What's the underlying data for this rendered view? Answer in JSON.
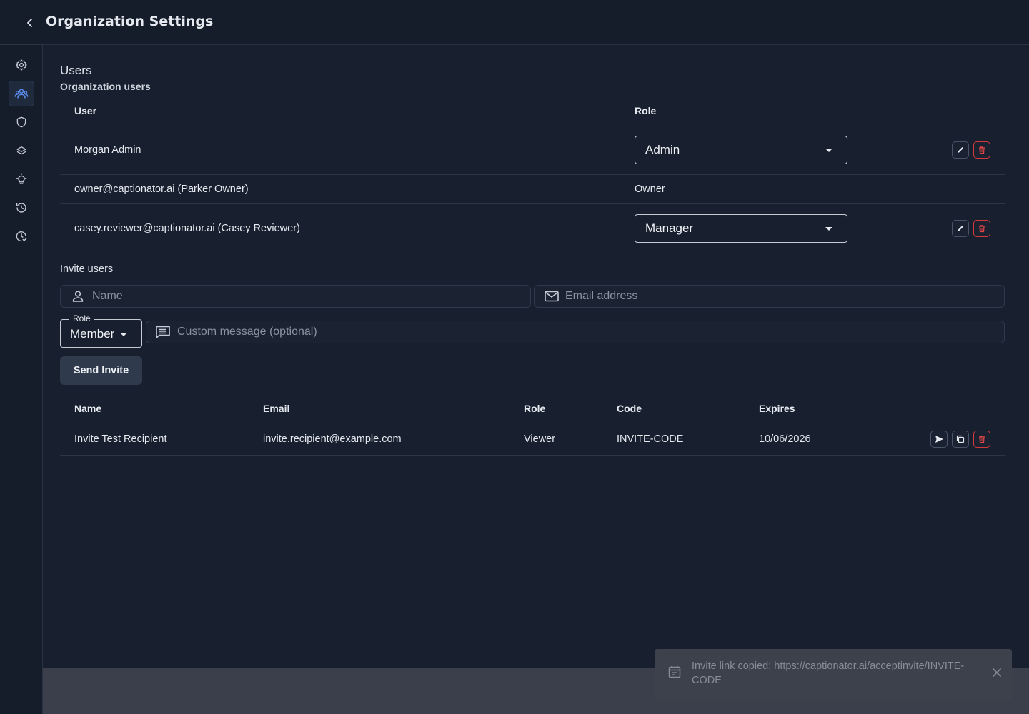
{
  "header": {
    "title": "Organization Settings"
  },
  "sidebar": {
    "items": [
      {
        "icon": "gear-icon"
      },
      {
        "icon": "users-icon",
        "active": true
      },
      {
        "icon": "shield-icon"
      },
      {
        "icon": "layers-icon"
      },
      {
        "icon": "lightbulb-icon"
      },
      {
        "icon": "history-icon"
      },
      {
        "icon": "clock-check-icon"
      }
    ]
  },
  "users": {
    "title": "Users",
    "subtitle": "Organization users",
    "columns": {
      "user": "User",
      "role": "Role"
    },
    "rows": [
      {
        "user": "Morgan Admin",
        "role": "Admin",
        "editable": true
      },
      {
        "user": "owner@captionator.ai (Parker Owner)",
        "role": "Owner",
        "editable": false
      },
      {
        "user": "casey.reviewer@captionator.ai (Casey Reviewer)",
        "role": "Manager",
        "editable": true
      }
    ]
  },
  "invite": {
    "title": "Invite users",
    "name_placeholder": "Name",
    "email_placeholder": "Email address",
    "role_label": "Role",
    "role_value": "Member",
    "message_placeholder": "Custom message (optional)",
    "send_label": "Send Invite"
  },
  "invites_table": {
    "columns": {
      "name": "Name",
      "email": "Email",
      "role": "Role",
      "code": "Code",
      "expires": "Expires"
    },
    "rows": [
      {
        "name": "Invite Test Recipient",
        "email": "invite.recipient@example.com",
        "role": "Viewer",
        "code": "INVITE-CODE",
        "expires": "10/06/2026"
      }
    ]
  },
  "toast": {
    "message": "Invite link copied: https://captionator.ai/acceptinvite/INVITE-CODE"
  },
  "colors": {
    "background": "#18202f",
    "accent": "#5b8def",
    "danger": "#d33a3a"
  }
}
